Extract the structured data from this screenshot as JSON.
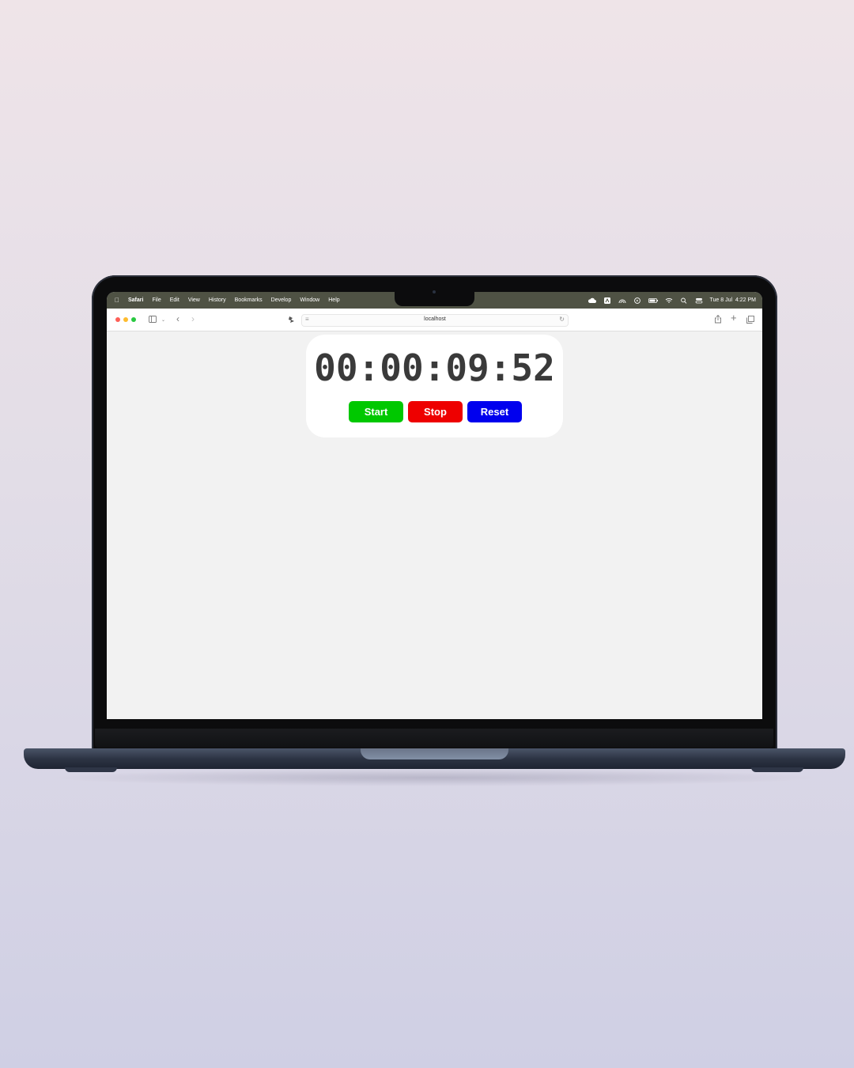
{
  "menubar": {
    "app": "Safari",
    "items": [
      "File",
      "Edit",
      "View",
      "History",
      "Bookmarks",
      "Develop",
      "Window",
      "Help"
    ],
    "clock": "Tue 8 Jul  4:22 PM"
  },
  "browser": {
    "url": "localhost"
  },
  "stopwatch": {
    "time": "00:00:09:52",
    "start_label": "Start",
    "stop_label": "Stop",
    "reset_label": "Reset"
  },
  "colors": {
    "start": "#00c800",
    "stop": "#ee0000",
    "reset": "#0000ee",
    "menubar": "#4f5244"
  }
}
